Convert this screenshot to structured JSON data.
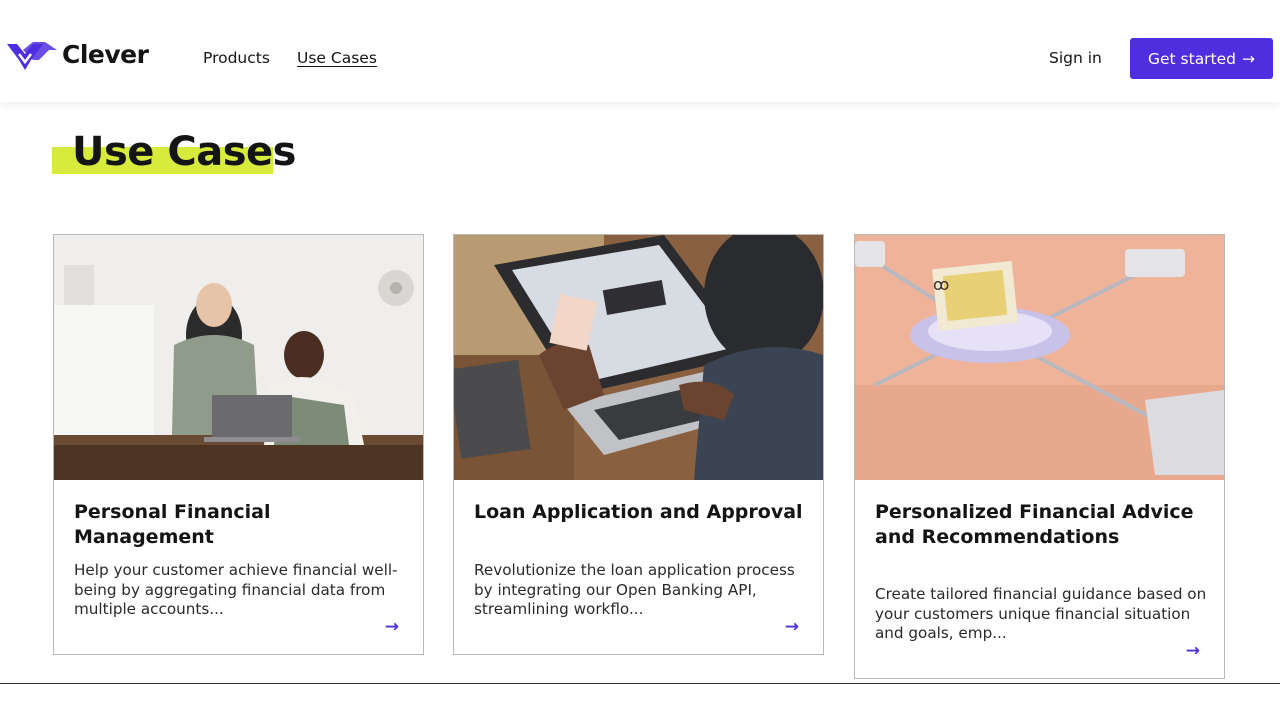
{
  "brand": {
    "name": "Clever",
    "accent": "#4f2ee0",
    "highlight": "#d6eb3c",
    "logo_icon": "clever-wing-logo"
  },
  "nav": {
    "products": "Products",
    "use_cases": "Use Cases"
  },
  "header": {
    "sign_in": "Sign in",
    "get_started": "Get started",
    "get_started_icon": "arrow-right-icon"
  },
  "page": {
    "title": "Use Cases"
  },
  "cards": [
    {
      "title": "Personal Financial Management",
      "description": "Help your customer achieve financial well-being by aggregating financial data from multiple accounts...",
      "image": "two-people-at-laptop-cafe",
      "arrow": "→"
    },
    {
      "title": "Loan Application and Approval",
      "description": "Revolutionize the loan application process by integrating our Open Banking API, streamlining workflo...",
      "image": "person-typing-on-laptop-with-card",
      "arrow": "→"
    },
    {
      "title": "Personalized Financial Advice and Recommendations",
      "description": "Create tailored financial guidance based on your customers unique financial situation and goals, emp...",
      "image": "3d-connected-network-hub",
      "arrow": "→"
    }
  ]
}
